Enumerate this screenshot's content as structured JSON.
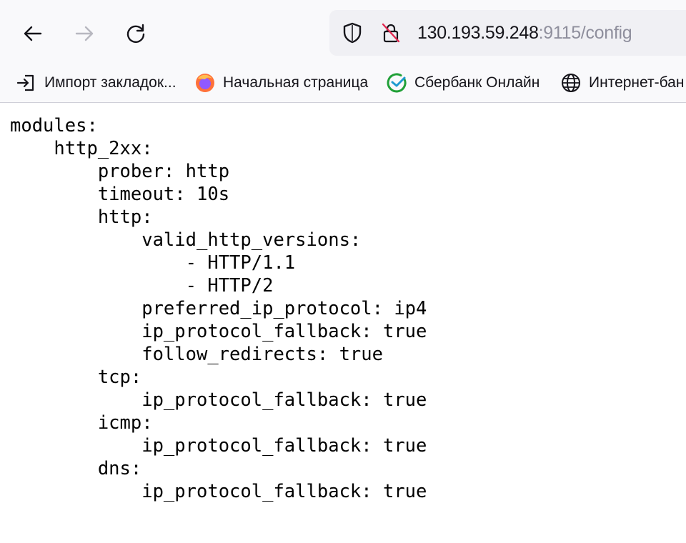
{
  "browser": {
    "url_host": "130.193.59.248",
    "url_rest": ":9115/config",
    "icons": {
      "back": "arrow-left-icon",
      "forward": "arrow-right-icon",
      "reload": "reload-icon",
      "tracking": "shield-icon",
      "security": "insecure-lock-icon"
    },
    "colors": {
      "toolbar": "#f9f9fb",
      "urlbar": "#f0f0f4",
      "url_dim": "#8f8f9d"
    }
  },
  "bookmarks": [
    {
      "label": "Импорт закладок...",
      "icon": "import-icon"
    },
    {
      "label": "Начальная страница",
      "icon": "firefox-icon"
    },
    {
      "label": "Сбербанк Онлайн",
      "icon": "sberbank-icon"
    },
    {
      "label": "Интернет-бан",
      "icon": "globe-icon"
    }
  ],
  "config_lines": [
    "modules:",
    "    http_2xx:",
    "        prober: http",
    "        timeout: 10s",
    "        http:",
    "            valid_http_versions:",
    "                - HTTP/1.1",
    "                - HTTP/2",
    "            preferred_ip_protocol: ip4",
    "            ip_protocol_fallback: true",
    "            follow_redirects: true",
    "        tcp:",
    "            ip_protocol_fallback: true",
    "        icmp:",
    "            ip_protocol_fallback: true",
    "        dns:",
    "            ip_protocol_fallback: true"
  ]
}
